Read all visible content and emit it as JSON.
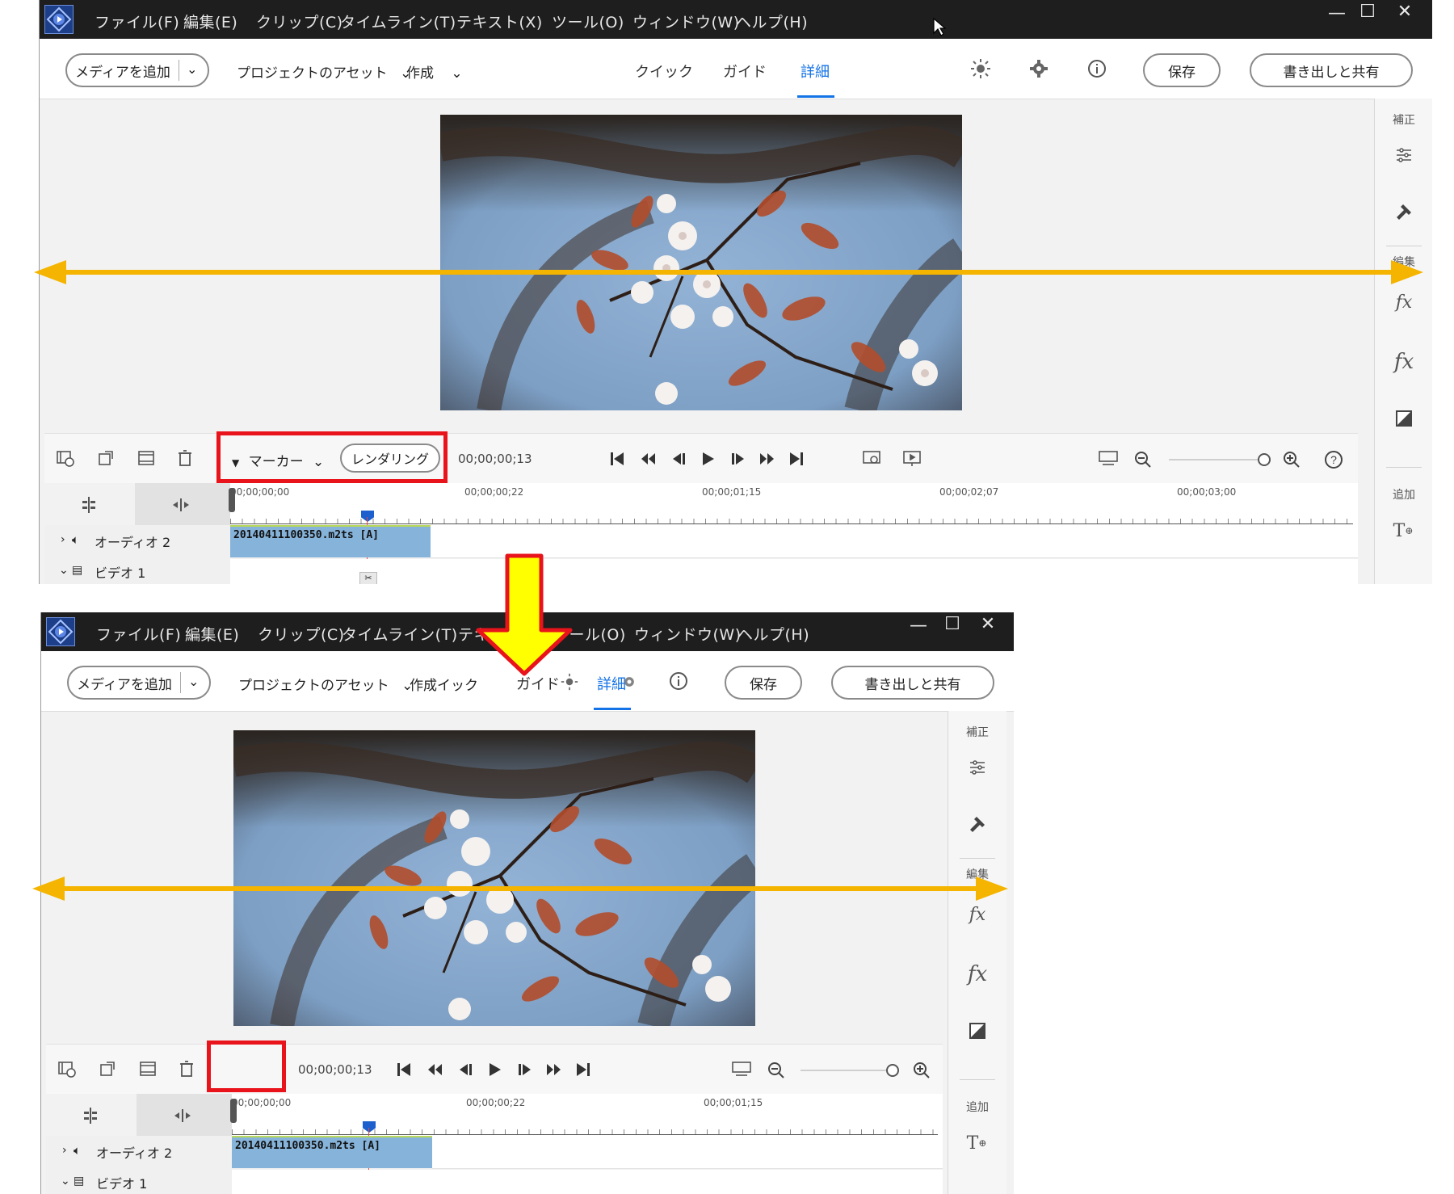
{
  "menu": [
    "ファイル(F)",
    "編集(E)",
    "クリップ(C)",
    "タイムライン(T)",
    "テキスト(X)",
    "ツール(O)",
    "ウィンドウ(W)",
    "ヘルプ(H)"
  ],
  "menu_bottom_partial": [
    "ファイル(F)",
    "編集(E)",
    "クリップ(C)",
    "タイムライン(T)",
    "テキ",
    "ツール(O)",
    "ウィンドウ(W)",
    "ヘルプ(H)"
  ],
  "window_controls": {
    "minimize": "—",
    "maximize": "☐",
    "close": "✕"
  },
  "toolbar": {
    "add_media": "メディアを追加",
    "project_assets": "プロジェクトのアセット",
    "create": "作成",
    "tabs": [
      "クイック",
      "ガイド",
      "詳細"
    ],
    "active_tab": "詳細",
    "save": "保存",
    "export": "書き出しと共有"
  },
  "toolbar_bottom": {
    "create_overlap": "作成イック",
    "guide": "ガイド",
    "detail": "詳細"
  },
  "right_panel": {
    "adjust": "補正",
    "edit_partial": "編集",
    "add": "追加"
  },
  "transport": {
    "marker": "マーカー",
    "render": "レンダリング",
    "timecode": "00;00;00;13"
  },
  "ruler_top": [
    "00;00;00;00",
    "00;00;00;22",
    "00;00;01;15",
    "00;00;02;07",
    "00;00;03;00"
  ],
  "ruler_bottom": [
    "00;00;00;00",
    "00;00;00;22",
    "00;00;01;15"
  ],
  "tracks": {
    "audio": "オーディオ 2",
    "video": "ビデオ 1",
    "clip": "20140411100350.m2ts [A]"
  },
  "colors": {
    "menubar": "#1e1e1e",
    "accent": "#1473e6",
    "clip": "#86b3d9",
    "highlight_box": "#e8131b",
    "annotation_arrow": "#f4b400",
    "down_arrow": "#ffff00"
  }
}
